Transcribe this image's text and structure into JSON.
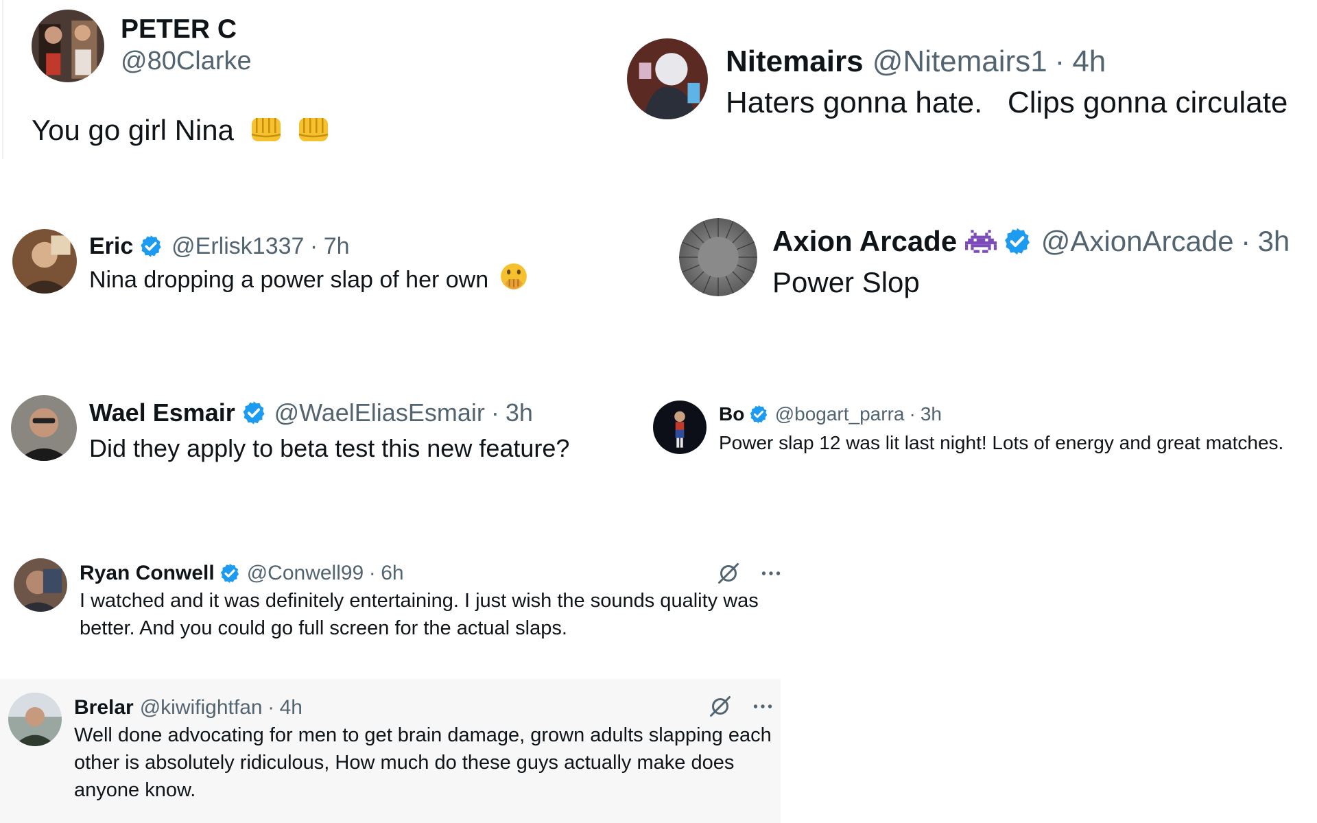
{
  "posts": [
    {
      "name": "PETER C",
      "handle": "@80Clarke",
      "text": "You go girl Nina",
      "emoji": "oncoming-fist-icon"
    },
    {
      "name": "Nitemairs",
      "handle": "@Nitemairs1",
      "separator": "·",
      "time": "4h",
      "text": "Haters gonna hate.   Clips gonna circulate"
    },
    {
      "name": "Eric",
      "handle": "@Erlisk1337",
      "separator": "·",
      "time": "7h",
      "text": "Nina dropping a power slap of her own",
      "emoji": "face-with-hand-over-mouth-icon",
      "verified": true
    },
    {
      "name": "Axion Arcade",
      "name_emoji": "space-invader-icon",
      "handle": "@AxionArcade",
      "separator": "·",
      "time": "3h",
      "text": "Power Slop",
      "verified": true
    },
    {
      "name": "Wael Esmair",
      "handle": "@WaelEliasEsmair",
      "separator": "·",
      "time": "3h",
      "text": "Did they apply to beta test this new feature?",
      "verified": true
    },
    {
      "name": "Bo",
      "handle": "@bogart_parra",
      "separator": "·",
      "time": "3h",
      "text": "Power slap 12 was lit last night! Lots of energy and great matches.",
      "verified": true
    },
    {
      "name": "Ryan Conwell",
      "handle": "@Conwell99",
      "separator": "·",
      "time": "6h",
      "text": "I watched and it was definitely entertaining. I just wish the sounds quality was better. And you could go full screen for the actual slaps.",
      "verified": true,
      "actions": [
        "grok-icon",
        "more-icon"
      ]
    },
    {
      "name": "Brelar",
      "handle": "@kiwifightfan",
      "separator": "·",
      "time": "4h",
      "text": "Well done advocating for men to get brain damage, grown adults slapping each other is absolutely ridiculous, How much do these guys actually make does anyone know.",
      "actions": [
        "grok-icon",
        "more-icon"
      ]
    }
  ],
  "colors": {
    "text": "#0f1419",
    "secondary": "#536471",
    "verified": "#1d9bf0",
    "highlight_bg": "#f7f7f7",
    "fist": "#f6c12f",
    "invader": "#7b4bb7"
  }
}
